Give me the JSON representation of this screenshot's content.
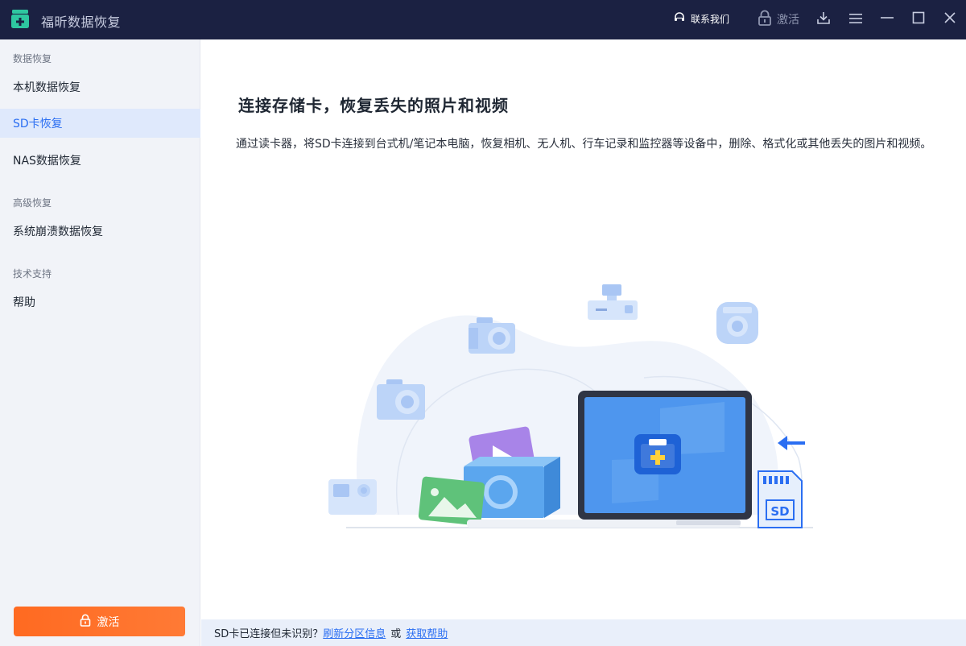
{
  "app": {
    "title": "福昕数据恢复"
  },
  "titlebar": {
    "contact_label": "联系我们",
    "activate_label": "激活"
  },
  "sidebar": {
    "sections": [
      {
        "title": "数据恢复"
      },
      {
        "title": "高级恢复"
      },
      {
        "title": "技术支持"
      }
    ],
    "items": [
      {
        "label": "本机数据恢复"
      },
      {
        "label": "SD卡恢复"
      },
      {
        "label": "NAS数据恢复"
      },
      {
        "label": "系统崩溃数据恢复"
      },
      {
        "label": "帮助"
      }
    ],
    "activate_button": "激活"
  },
  "main": {
    "title": "连接存储卡，恢复丢失的照片和视频",
    "description": "通过读卡器，将SD卡连接到台式机/笔记本电脑，恢复相机、无人机、行车记录和监控器等设备中，删除、格式化或其他丢失的图片和视频。",
    "sd_label": "SD"
  },
  "footer": {
    "text": "SD卡已连接但未识别？",
    "refresh_link": "刷新分区信息",
    "or": "或",
    "help_link": "获取帮助"
  },
  "colors": {
    "titlebar": "#1b2142",
    "accent": "#2a6ef2",
    "activate": "#ff6a21",
    "sidebar": "#f1f3f8"
  }
}
